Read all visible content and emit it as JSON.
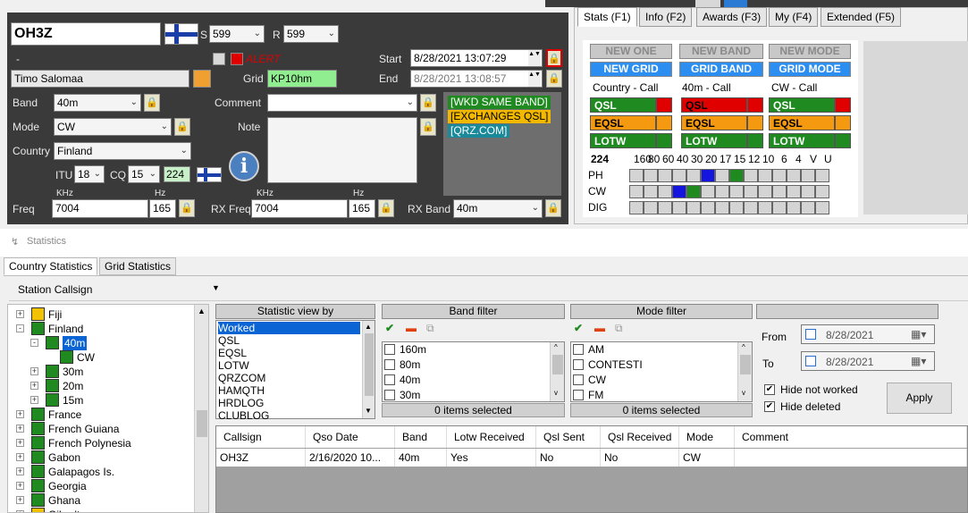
{
  "qso": {
    "callsign": "OH3Z",
    "name": "Timo Salomaa",
    "dash": "-",
    "s_label": "S",
    "s_value": "599",
    "r_label": "R",
    "r_value": "599",
    "alert": "ALERT",
    "grid_label": "Grid",
    "grid_value": "KP10hm",
    "start_label": "Start",
    "start_value": "8/28/2021 13:07:29",
    "end_label": "End",
    "end_value": "8/28/2021 13:08:57",
    "band_label": "Band",
    "band_value": "40m",
    "mode_label": "Mode",
    "mode_value": "CW",
    "country_label": "Country",
    "country_value": "Finland",
    "itu_label": "ITU",
    "itu_value": "18",
    "cq_label": "CQ",
    "cq_value": "15",
    "dxcc_value": "224",
    "comment_label": "Comment",
    "note_label": "Note",
    "freq_label": "Freq",
    "khz_label": "KHz",
    "hz_label": "Hz",
    "freq_khz": "7004",
    "freq_hz": "165",
    "rxfreq_label": "RX Freq",
    "rxfreq_khz": "7004",
    "rxfreq_hz": "165",
    "rxband_label": "RX Band",
    "rxband_value": "40m",
    "tags": [
      "[WKD SAME BAND]",
      "[EXCHANGES QSL]",
      "[QRZ.COM]"
    ],
    "tag_colors": [
      "#1f8a1f",
      "#f2b800",
      "#1a8a9a"
    ]
  },
  "right_tabs": [
    "Stats (F1)",
    "Info (F2)",
    "Awards (F3)",
    "My (F4)",
    "Extended (F5)"
  ],
  "stats": {
    "new_one": "NEW ONE",
    "new_band": "NEW BAND",
    "new_mode": "NEW MODE",
    "new_grid": "NEW GRID",
    "grid_band": "GRID BAND",
    "grid_mode": "GRID MODE",
    "col1_title": "Country - Call",
    "col2_title": "40m - Call",
    "col3_title": "CW - Call",
    "qsl": "QSL",
    "eqsl": "EQSL",
    "lotw": "LOTW",
    "dxcc": "224",
    "bands": [
      "160",
      "80",
      "60",
      "40",
      "30",
      "20",
      "17",
      "15",
      "12",
      "10",
      "6",
      "4",
      "V",
      "U"
    ],
    "modes": [
      "PH",
      "CW",
      "DIG"
    ],
    "matrix": [
      [
        "n",
        "n",
        "n",
        "n",
        "n",
        "b",
        "n",
        "g",
        "n",
        "n",
        "n",
        "n",
        "n",
        "n"
      ],
      [
        "n",
        "n",
        "n",
        "b",
        "g",
        "n",
        "n",
        "n",
        "n",
        "n",
        "n",
        "n",
        "n",
        "n"
      ],
      [
        "n",
        "n",
        "n",
        "n",
        "n",
        "n",
        "n",
        "n",
        "n",
        "n",
        "n",
        "n",
        "n",
        "n"
      ]
    ]
  },
  "statistics_title": "Statistics",
  "bottom_tabs": [
    "Country Statistics",
    "Grid Statistics"
  ],
  "station_callsign": "Station Callsign",
  "tree": [
    {
      "label": "Fiji",
      "color": "#f2c200",
      "level": 0,
      "pm": "+"
    },
    {
      "label": "Finland",
      "color": "#1f8a1f",
      "level": 0,
      "pm": "-"
    },
    {
      "label": "40m",
      "color": "#1f8a1f",
      "level": 1,
      "pm": "-",
      "selected": true
    },
    {
      "label": "CW",
      "color": "#1f8a1f",
      "level": 2,
      "pm": ""
    },
    {
      "label": "30m",
      "color": "#1f8a1f",
      "level": 1,
      "pm": "+"
    },
    {
      "label": "20m",
      "color": "#1f8a1f",
      "level": 1,
      "pm": "+"
    },
    {
      "label": "15m",
      "color": "#1f8a1f",
      "level": 1,
      "pm": "+"
    },
    {
      "label": "France",
      "color": "#1f8a1f",
      "level": 0,
      "pm": "+"
    },
    {
      "label": "French Guiana",
      "color": "#1f8a1f",
      "level": 0,
      "pm": "+"
    },
    {
      "label": "French Polynesia",
      "color": "#1f8a1f",
      "level": 0,
      "pm": "+"
    },
    {
      "label": "Gabon",
      "color": "#1f8a1f",
      "level": 0,
      "pm": "+"
    },
    {
      "label": "Galapagos Is.",
      "color": "#1f8a1f",
      "level": 0,
      "pm": "+"
    },
    {
      "label": "Georgia",
      "color": "#1f8a1f",
      "level": 0,
      "pm": "+"
    },
    {
      "label": "Ghana",
      "color": "#1f8a1f",
      "level": 0,
      "pm": "+"
    },
    {
      "label": "Gibraltar",
      "color": "#f2c200",
      "level": 0,
      "pm": "+"
    }
  ],
  "view_by": {
    "title": "Statistic view by",
    "items": [
      "Worked",
      "QSL",
      "EQSL",
      "LOTW",
      "QRZCOM",
      "HAMQTH",
      "HRDLOG",
      "CLUBLOG"
    ]
  },
  "band_filter": {
    "title": "Band filter",
    "items": [
      "160m",
      "80m",
      "40m",
      "30m"
    ],
    "footer": "0 items selected"
  },
  "mode_filter": {
    "title": "Mode filter",
    "items": [
      "AM",
      "CONTESTI",
      "CW",
      "FM"
    ],
    "footer": "0 items selected"
  },
  "date_filter": {
    "from_label": "From",
    "from_value": "8/28/2021",
    "to_label": "To",
    "to_value": "8/28/2021",
    "hide_not_worked": "Hide not worked",
    "hide_deleted": "Hide deleted",
    "apply": "Apply"
  },
  "table": {
    "headers": [
      "Callsign",
      "Qso Date",
      "Band",
      "Lotw Received",
      "Qsl Sent",
      "Qsl Received",
      "Mode",
      "Comment"
    ],
    "rows": [
      [
        "OH3Z",
        "2/16/2020 10...",
        "40m",
        "Yes",
        "No",
        "No",
        "CW",
        ""
      ]
    ]
  }
}
